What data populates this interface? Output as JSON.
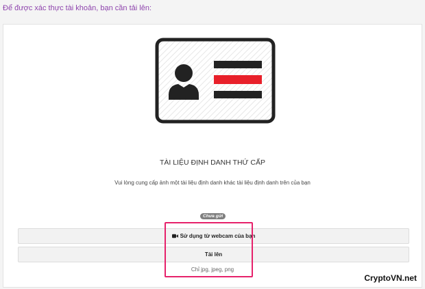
{
  "heading": "Để được xác thực tài khoản, bạn cần tải lên:",
  "document": {
    "title": "TÀI LIỆU ĐỊNH DANH THỨ CẤP",
    "description": "Vui lòng cung cấp ảnh một tài liệu định danh khác tài liệu định danh trên của bạn",
    "status": "Chưa gửi"
  },
  "actions": {
    "webcam_label": "Sử dụng từ webcam của bạn",
    "upload_label": "Tải lên",
    "file_types_hint": "Chỉ jpg, jpeg, png"
  },
  "watermark": "CryptoVN.net",
  "icons": {
    "id_card": "id-card-icon",
    "webcam": "video-camera-icon"
  },
  "colors": {
    "heading": "#8e44ad",
    "card_stroke": "#222222",
    "card_accent": "#e8202a",
    "highlight_border": "#e6206a",
    "badge": "#7f7f7f"
  }
}
